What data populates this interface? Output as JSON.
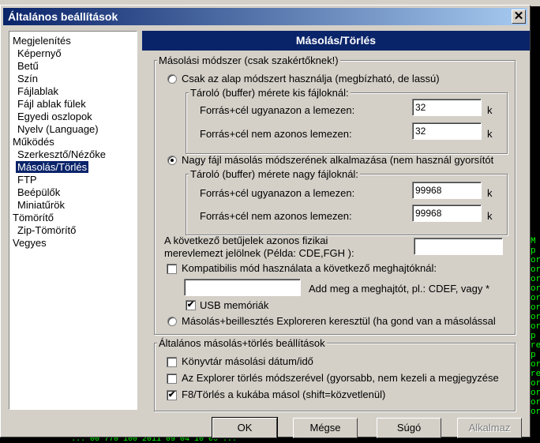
{
  "window": {
    "title": "Általános beállítások",
    "close_glyph": "✕"
  },
  "tree": [
    {
      "label": "Megjelenítés",
      "indent": 0
    },
    {
      "label": "Képernyő",
      "indent": 1
    },
    {
      "label": "Betű",
      "indent": 1
    },
    {
      "label": "Szín",
      "indent": 1
    },
    {
      "label": "Fájlablak",
      "indent": 1
    },
    {
      "label": "Fájl ablak fülek",
      "indent": 1
    },
    {
      "label": "Egyedi oszlopok",
      "indent": 1
    },
    {
      "label": "Nyelv (Language)",
      "indent": 1
    },
    {
      "label": "Működés",
      "indent": 0
    },
    {
      "label": "Szerkesztő/Nézőke",
      "indent": 1
    },
    {
      "label": "Másolás/Törlés",
      "indent": 1,
      "selected": true
    },
    {
      "label": "FTP",
      "indent": 1
    },
    {
      "label": "Beépülők",
      "indent": 1
    },
    {
      "label": "Miniatűrök",
      "indent": 1
    },
    {
      "label": "Tömörítő",
      "indent": 0
    },
    {
      "label": "Zip-Tömörítő",
      "indent": 1
    },
    {
      "label": "Vegyes",
      "indent": 0
    }
  ],
  "panel": {
    "title": "Másolás/Törlés",
    "method": {
      "legend": "Másolási módszer (csak szakértőknek!)",
      "radio1": "Csak az alap módszert használja (megbízható, de lassú)",
      "small_legend": "Tároló (buffer) mérete kis fájloknál:",
      "same_disk": "Forrás+cél ugyanazon a lemezen:",
      "diff_disk": "Forrás+cél nem azonos lemezen:",
      "small_same_val": "32",
      "small_diff_val": "32",
      "unit": "k",
      "radio2": "Nagy fájl másolás módszerének alkalmazása (nem használ gyorsítót",
      "big_legend": "Tároló (buffer) mérete nagy fájloknál:",
      "big_same_val": "99968",
      "big_diff_val": "99968",
      "letters_label_1": "A következő betűjelek azonos fizikai",
      "letters_label_2": "merevlemezt jelölnek (Példa: CDE,FGH ):",
      "letters_val": "",
      "compat_label": "Kompatibilis mód használata a következő meghajtóknál:",
      "compat_val": "",
      "compat_hint": "Add meg a meghajtót, pl.: CDEF, vagy *",
      "usb_label": "USB memóriák",
      "radio3": "Másolás+beillesztés Exploreren keresztül (ha gond van a másolással"
    },
    "general": {
      "legend": "Általános másolás+törlés beállítások",
      "opt1": "Könyvtár másolási dátum/idő",
      "opt2": "Az Explorer törlés módszerével (gyorsabb, nem kezeli a megjegyzése",
      "opt3": "F8/Törlés a kukába másol (shift=közvetlenül)",
      "opt1_checked": false,
      "opt2_checked": false,
      "opt3_checked": true
    }
  },
  "buttons": {
    "ok": "OK",
    "cancel": "Mégse",
    "help": "Súgó",
    "apply": "Alkalmaz"
  },
  "background": {
    "right_col": "M\np\nor\nor\nor\nor\nor\nor\nor\nor\np\nre\np\nor\nre\nor\nor\nor\nor",
    "bottom_line": "... 00 770 100 2011 09 04 10 00 ..."
  }
}
